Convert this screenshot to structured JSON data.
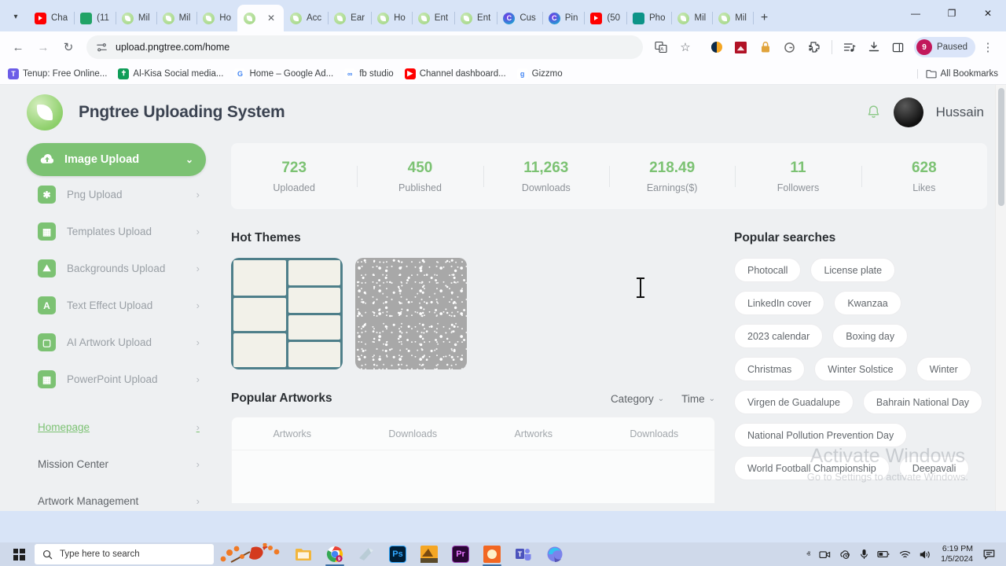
{
  "browser": {
    "tabs": [
      {
        "title": "Cha",
        "icon": "youtube-icon",
        "active": false
      },
      {
        "title": "(11",
        "icon": "green-icon",
        "active": false
      },
      {
        "title": "Mil",
        "icon": "pngtree-icon",
        "active": false
      },
      {
        "title": "Mil",
        "icon": "pngtree-icon",
        "active": false
      },
      {
        "title": "Ho",
        "icon": "pngtree-icon",
        "active": false
      },
      {
        "title": "",
        "icon": "pngtree-icon",
        "active": true
      },
      {
        "title": "Acc",
        "icon": "pngtree-icon",
        "active": false
      },
      {
        "title": "Ear",
        "icon": "pngtree-icon",
        "active": false
      },
      {
        "title": "Ho",
        "icon": "pngtree-icon",
        "active": false
      },
      {
        "title": "Ent",
        "icon": "pngtree-icon",
        "active": false
      },
      {
        "title": "Ent",
        "icon": "pngtree-icon",
        "active": false
      },
      {
        "title": "Cus",
        "icon": "canva-icon",
        "active": false
      },
      {
        "title": "Pin",
        "icon": "canva-icon",
        "active": false
      },
      {
        "title": "(50",
        "icon": "youtube-icon",
        "active": false
      },
      {
        "title": "Pho",
        "icon": "teal-icon",
        "active": false
      },
      {
        "title": "Mil",
        "icon": "pngtree-icon",
        "active": false
      },
      {
        "title": "Mil",
        "icon": "pngtree-icon",
        "active": false
      }
    ],
    "new_tab_label": "+",
    "tab_close_label": "✕",
    "window_controls": {
      "minimize": "—",
      "maximize": "❐",
      "close": "✕"
    },
    "nav": {
      "back": "←",
      "forward": "→",
      "reload": "↻"
    },
    "url": "upload.pngtree.com/home",
    "extensions_pill": {
      "count": "9",
      "label": "Paused"
    },
    "bookmarks": [
      {
        "label": "Tenup: Free Online...",
        "icon": "tenup-icon",
        "color": "#6b5ce7",
        "glyph": "T"
      },
      {
        "label": "Al-Kisa Social media...",
        "icon": "alkisa-icon",
        "color": "#0f9d58",
        "glyph": "✝"
      },
      {
        "label": "Home – Google Ad...",
        "icon": "google-icon",
        "color": "#ffffff",
        "glyph": "G"
      },
      {
        "label": "fb studio",
        "icon": "meta-icon",
        "color": "#ffffff",
        "glyph": "∞"
      },
      {
        "label": "Channel dashboard...",
        "icon": "youtube-icon",
        "color": "#ff0000",
        "glyph": "▶"
      },
      {
        "label": "Gizzmo",
        "icon": "gizzmo-icon",
        "color": "#ffffff",
        "glyph": "g"
      }
    ],
    "all_bookmarks_label": "All Bookmarks"
  },
  "site": {
    "title": "Pngtree Uploading System",
    "user": "Hussain",
    "brand_green": "#7cc273"
  },
  "sidebar": {
    "primary": {
      "label": "Image Upload",
      "icon": "cloud-upload-icon",
      "chevron": "⌄"
    },
    "items": [
      {
        "label": "Png Upload",
        "icon": "png-icon",
        "glyph": "✱"
      },
      {
        "label": "Templates Upload",
        "icon": "templates-icon",
        "glyph": "▦"
      },
      {
        "label": "Backgrounds Upload",
        "icon": "backgrounds-icon",
        "glyph": "⛰"
      },
      {
        "label": "Text Effect Upload",
        "icon": "text-effect-icon",
        "glyph": "A"
      },
      {
        "label": "AI Artwork Upload",
        "icon": "ai-artwork-icon",
        "glyph": "▢"
      },
      {
        "label": "PowerPoint Upload",
        "icon": "powerpoint-icon",
        "glyph": "▦"
      }
    ],
    "links": [
      {
        "label": "Homepage",
        "active": true
      },
      {
        "label": "Mission Center",
        "active": false
      },
      {
        "label": "Artwork Management",
        "active": false
      }
    ],
    "arrow": "›"
  },
  "stats": [
    {
      "value": "723",
      "label": "Uploaded",
      "highlight": false
    },
    {
      "value": "450",
      "label": "Published",
      "highlight": false
    },
    {
      "value": "11,263",
      "label": "Downloads",
      "highlight": false
    },
    {
      "value": "218.49",
      "label": "Earnings($)",
      "highlight": true
    },
    {
      "value": "11",
      "label": "Followers",
      "highlight": false
    },
    {
      "value": "628",
      "label": "Likes",
      "highlight": false
    }
  ],
  "hot_themes": {
    "title": "Hot Themes",
    "cards": [
      {
        "name": "infographic-template-thumbnail"
      },
      {
        "name": "starry-texture-thumbnail"
      }
    ]
  },
  "popular_artworks": {
    "title": "Popular Artworks",
    "filters": [
      {
        "label": "Category",
        "chevron": "⌄"
      },
      {
        "label": "Time",
        "chevron": "⌄"
      }
    ],
    "columns": [
      "Artworks",
      "Downloads",
      "Artworks",
      "Downloads"
    ],
    "rows": []
  },
  "popular_searches": {
    "title": "Popular searches",
    "tags": [
      "Photocall",
      "License plate",
      "LinkedIn cover",
      "Kwanzaa",
      "2023 calendar",
      "Boxing day",
      "Christmas",
      "Winter Solstice",
      "Winter",
      "Virgen de Guadalupe",
      "Bahrain National Day",
      "National Pollution Prevention Day",
      "World Football Championship",
      "Deepavali"
    ]
  },
  "watermark": {
    "line1": "Activate Windows",
    "line2": "Go to Settings to activate Windows."
  },
  "taskbar": {
    "search_placeholder": "Type here to search",
    "apps": [
      {
        "name": "file-explorer-icon",
        "glyph": "🗁",
        "color": "#e8b23a",
        "open": false
      },
      {
        "name": "chrome-icon",
        "glyph": "",
        "color": "#4285f4",
        "open": true
      },
      {
        "name": "notes-icon",
        "glyph": "",
        "color": "#9fb8c4",
        "open": false
      },
      {
        "name": "photoshop-icon",
        "glyph": "Ps",
        "color": "#001e36",
        "open": false
      },
      {
        "name": "illustrator-icon",
        "glyph": "Ai",
        "color": "#ff9a00",
        "open": false
      },
      {
        "name": "premiere-icon",
        "glyph": "Pr",
        "color": "#2a0634",
        "open": false
      },
      {
        "name": "orange-app-icon",
        "glyph": "",
        "color": "#f26722",
        "open": true
      },
      {
        "name": "teams-icon",
        "glyph": "T",
        "color": "#4b53bc",
        "open": false
      },
      {
        "name": "edge-icon",
        "glyph": "",
        "color": "#3b82d6",
        "open": false
      }
    ],
    "tray": {
      "chevron": "ⱏ",
      "icons": [
        "camera-icon",
        "cloud-sync-icon",
        "microphone-icon",
        "battery-icon",
        "wifi-icon",
        "volume-icon"
      ],
      "time": "6:19 PM",
      "date": "1/5/2024",
      "notification": "notifications-icon"
    }
  }
}
